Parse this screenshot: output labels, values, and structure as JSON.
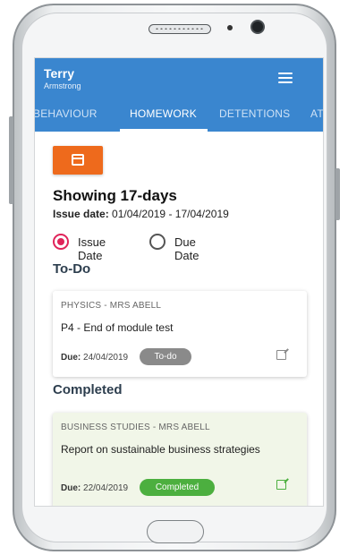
{
  "user": {
    "first_name": "Terry",
    "last_name": "Armstrong"
  },
  "tabs": [
    {
      "label": "BEHAVIOUR",
      "active": false
    },
    {
      "label": "HOMEWORK",
      "active": true
    },
    {
      "label": "DETENTIONS",
      "active": false
    },
    {
      "label": "AT",
      "active": false
    }
  ],
  "filter": {
    "showing": "Showing 17-days",
    "issue_date_label": "Issue date:",
    "issue_date_range": "01/04/2019 - 17/04/2019",
    "radio_issue": "Issue Date",
    "radio_due": "Due Date",
    "selected": "Issue Date"
  },
  "todo": {
    "heading": "To-Do",
    "items": [
      {
        "subject": "PHYSICS - MRS ABELL",
        "title": "P4 - End of module test",
        "due_label": "Due:",
        "due_date": "24/04/2019",
        "status": "To-do"
      }
    ]
  },
  "completed": {
    "heading": "Completed",
    "items": [
      {
        "subject": "BUSINESS STUDIES - MRS ABELL",
        "title": "Report on sustainable business strategies",
        "due_label": "Due:",
        "due_date": "22/04/2019",
        "status": "Completed"
      }
    ]
  },
  "colors": {
    "appbar": "#3a86cf",
    "accent_orange": "#ee6a1c",
    "radio_selected": "#e0245a",
    "completed_green": "#4caf3f",
    "todo_grey": "#8a8a8a"
  }
}
